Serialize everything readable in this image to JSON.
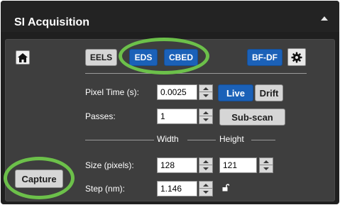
{
  "header": {
    "title": "SI Acquisition"
  },
  "toolbar": {
    "eels_label": "EELS",
    "eds_label": "EDS",
    "cbed_label": "CBED",
    "bfdf_label": "BF-DF"
  },
  "pixel_time": {
    "label": "Pixel Time (s):",
    "value": "0.0025"
  },
  "passes": {
    "label": "Passes:",
    "value": "1"
  },
  "live_label": "Live",
  "drift_label": "Drift",
  "subscan_label": "Sub-scan",
  "columns": {
    "width_label": "Width",
    "height_label": "Height"
  },
  "size": {
    "label": "Size (pixels):",
    "width": "128",
    "height": "121"
  },
  "step": {
    "label": "Step (nm):",
    "value": "1.146"
  },
  "capture_label": "Capture",
  "colors": {
    "accent_blue": "#1b61b8",
    "highlight_ring": "#6cc04a",
    "panel_bg": "#3e3e3e",
    "header_bg": "#232323"
  },
  "icons": [
    "home-icon",
    "gear-icon",
    "lock-icon",
    "collapse-icon",
    "spin-up-icon",
    "spin-down-icon"
  ]
}
